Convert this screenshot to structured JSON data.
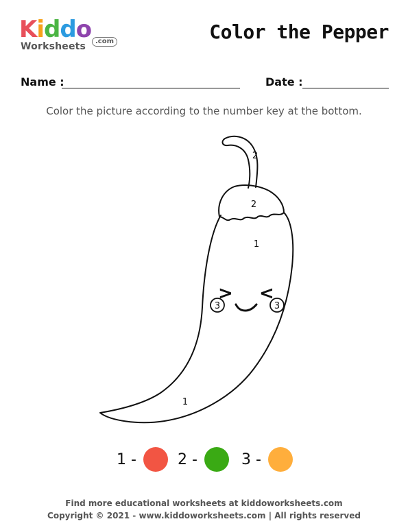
{
  "logo": {
    "letters": [
      "K",
      "i",
      "d",
      "d",
      "o"
    ],
    "letter_colors": [
      "#e8505b",
      "#f7a21b",
      "#4bb543",
      "#2c9be0",
      "#8e44ad"
    ],
    "sub": "Worksheets",
    "com": ".com"
  },
  "title": "Color the Pepper",
  "fields": {
    "name_label": "Name :",
    "date_label": "Date :"
  },
  "instructions": "Color the picture according to the number key at the bottom.",
  "picture": {
    "region_labels": {
      "stem": "2",
      "cap": "2",
      "body_top": "1",
      "body_bottom": "1",
      "cheek_left": "3",
      "cheek_right": "3"
    },
    "eyes": {
      "left": ">",
      "right": "<"
    }
  },
  "key": [
    {
      "label": "1 -",
      "color": "#f25543"
    },
    {
      "label": "2 -",
      "color": "#3aaa14"
    },
    {
      "label": "3 -",
      "color": "#ffae3c"
    }
  ],
  "footer": {
    "line1": "Find more educational worksheets at kiddoworksheets.com",
    "line2": "Copyright © 2021 - www.kiddoworksheets.com  |  All rights reserved"
  }
}
